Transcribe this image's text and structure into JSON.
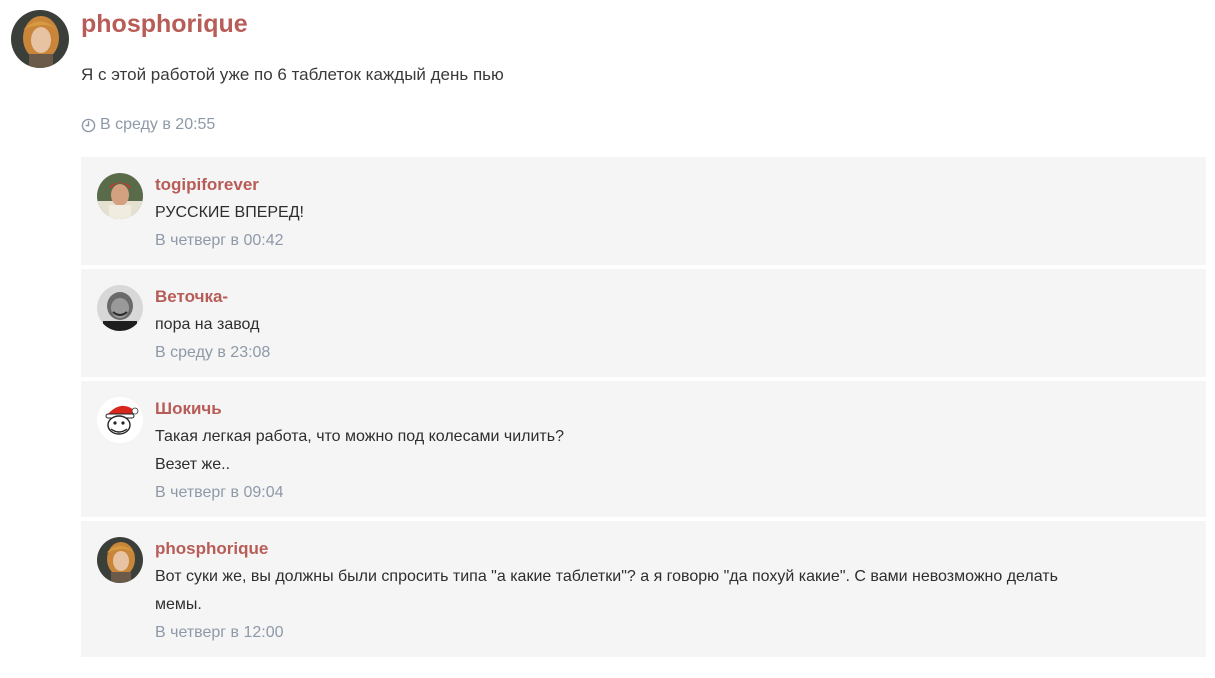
{
  "post": {
    "author": "phosphorique",
    "text": "Я с этой работой уже по 6 таблеток каждый день пью",
    "time": "В среду в 20:55"
  },
  "replies": [
    {
      "author": "togipiforever",
      "lines": [
        "РУССКИЕ ВПЕРЕД!"
      ],
      "time": "В четверг в 00:42"
    },
    {
      "author": "Веточка-",
      "lines": [
        "пора на завод"
      ],
      "time": "В среду в 23:08"
    },
    {
      "author": "Шокичь",
      "lines": [
        "Такая легкая работа, что можно под колесами чилить?",
        "Везет же.."
      ],
      "time": "В четверг в 09:04"
    },
    {
      "author": "phosphorique",
      "lines": [
        "Вот суки же, вы должны были спросить типа \"а какие таблетки\"? а я говорю \"да похуй какие\". С вами невозможно делать",
        "мемы."
      ],
      "time": "В четверг в 12:00"
    }
  ],
  "icons": {
    "time": "clock-icon"
  },
  "colors": {
    "username": "#b85c57",
    "timestamp": "#8e99a8",
    "reply_background": "#f5f5f5"
  }
}
